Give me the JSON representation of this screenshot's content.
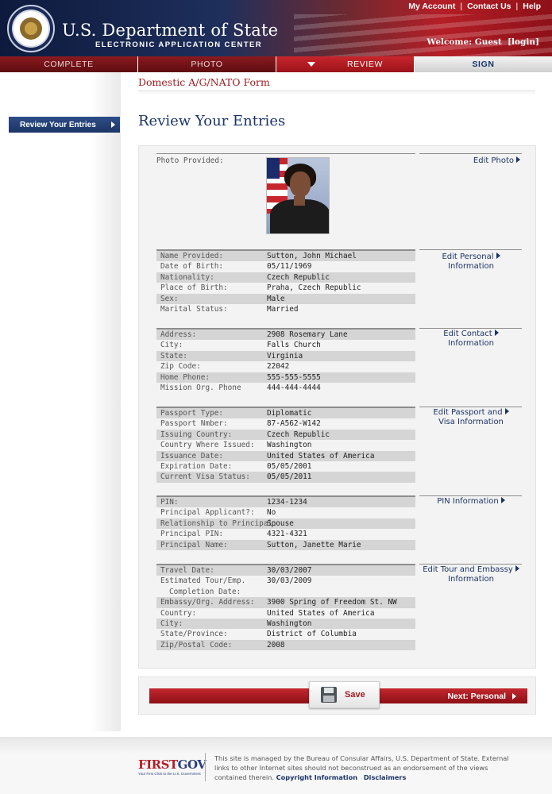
{
  "header": {
    "title": "U.S. Department of State",
    "subtitle": "ELECTRONIC APPLICATION CENTER",
    "util_links": [
      "My Account",
      "Contact Us",
      "Help"
    ],
    "welcome_prefix": "Welcome: Guest",
    "login_link": "[login]"
  },
  "tabs": [
    {
      "label": "COMPLETE",
      "state": "done"
    },
    {
      "label": "PHOTO",
      "state": "done"
    },
    {
      "label": "REVIEW",
      "state": "active"
    },
    {
      "label": "SIGN",
      "state": "pending"
    }
  ],
  "sidebar": {
    "items": [
      {
        "label": "Review Your Entries"
      }
    ]
  },
  "main": {
    "form_name": "Domestic A/G/NATO Form",
    "page_title": "Review Your Entries",
    "photo": {
      "label": "Photo Provided:",
      "edit_label": "Edit Photo"
    },
    "sections": [
      {
        "edit_label": [
          "Edit Personal",
          "Information"
        ],
        "rows": [
          {
            "label": "Name Provided:",
            "value": "Sutton, John Michael"
          },
          {
            "label": "Date of Birth:",
            "value": "05/11/1969"
          },
          {
            "label": "Nationality:",
            "value": "Czech Republic"
          },
          {
            "label": "Place of Birth:",
            "value": "Praha, Czech Republic"
          },
          {
            "label": "Sex:",
            "value": "Male"
          },
          {
            "label": "Marital Status:",
            "value": "Married"
          }
        ]
      },
      {
        "edit_label": [
          "Edit Contact",
          "Information"
        ],
        "rows": [
          {
            "label": "Address:",
            "value": "2908 Rosemary Lane"
          },
          {
            "label": "City:",
            "value": "Falls Church"
          },
          {
            "label": "State:",
            "value": "Virginia"
          },
          {
            "label": "Zip Code:",
            "value": "22042"
          },
          {
            "label": "Home Phone:",
            "value": "555-555-5555"
          },
          {
            "label": "Mission Org. Phone",
            "value": "444-444-4444"
          }
        ]
      },
      {
        "edit_label": [
          "Edit Passport and",
          "Visa Information"
        ],
        "rows": [
          {
            "label": "Passport Type:",
            "value": "Diplomatic"
          },
          {
            "label": "Passport Nmber:",
            "value": "87-A562-W142"
          },
          {
            "label": "Issuing Country:",
            "value": "Czech Republic"
          },
          {
            "label": "Country Where Issued:",
            "value": "Washington"
          },
          {
            "label": "Issuance Date:",
            "value": "United States of America"
          },
          {
            "label": "Expiration Date:",
            "value": "05/05/2001"
          },
          {
            "label": "Current Visa Status:",
            "value": "05/05/2011"
          }
        ]
      },
      {
        "edit_label": [
          "PIN Information"
        ],
        "rows": [
          {
            "label": "PIN:",
            "value": "1234-1234"
          },
          {
            "label": "Principal Applicant?:",
            "value": "No"
          },
          {
            "label": "Relationship to Principal:",
            "value": "Spouse"
          },
          {
            "label": "Principal PIN:",
            "value": "4321-4321"
          },
          {
            "label": "Principal Name:",
            "value": "Sutton, Janette Marie"
          }
        ]
      },
      {
        "edit_label": [
          "Edit Tour and Embassy",
          "Information"
        ],
        "rows": [
          {
            "label": "Travel Date:",
            "value": "30/03/2007"
          },
          {
            "label": "Estimated Tour/Emp.",
            "label2": "Completion Date:",
            "value": "30/03/2009"
          },
          {
            "label": "Embassy/Org. Address:",
            "value": "3900 Spring of Freedom St. NW"
          },
          {
            "label": "Country:",
            "value": "United States of America"
          },
          {
            "label": "City:",
            "value": "Washington"
          },
          {
            "label": "State/Province:",
            "value": "District of Columbia"
          },
          {
            "label": "Zip/Postal Code:",
            "value": "2008"
          }
        ]
      }
    ]
  },
  "actions": {
    "save_label": "Save",
    "next_label": "Next:  Personal"
  },
  "footer": {
    "logo_word_first": "FIRST",
    "logo_word_gov": "GOV",
    "logo_tagline": "Your First Click to the U.S. Government",
    "text": "This site is managed by the Bureau of Consular Affairs, U.S. Department of State. External links to other Internet sites should not beconstrued as an endorsement of the views contained therein.",
    "link_copyright": "Copyright Information",
    "link_disclaimers": "Disclaimers"
  },
  "colors": {
    "brand_navy": "#1c3466",
    "brand_red": "#9a1a1f",
    "row_shade": "#d5d5d5"
  }
}
